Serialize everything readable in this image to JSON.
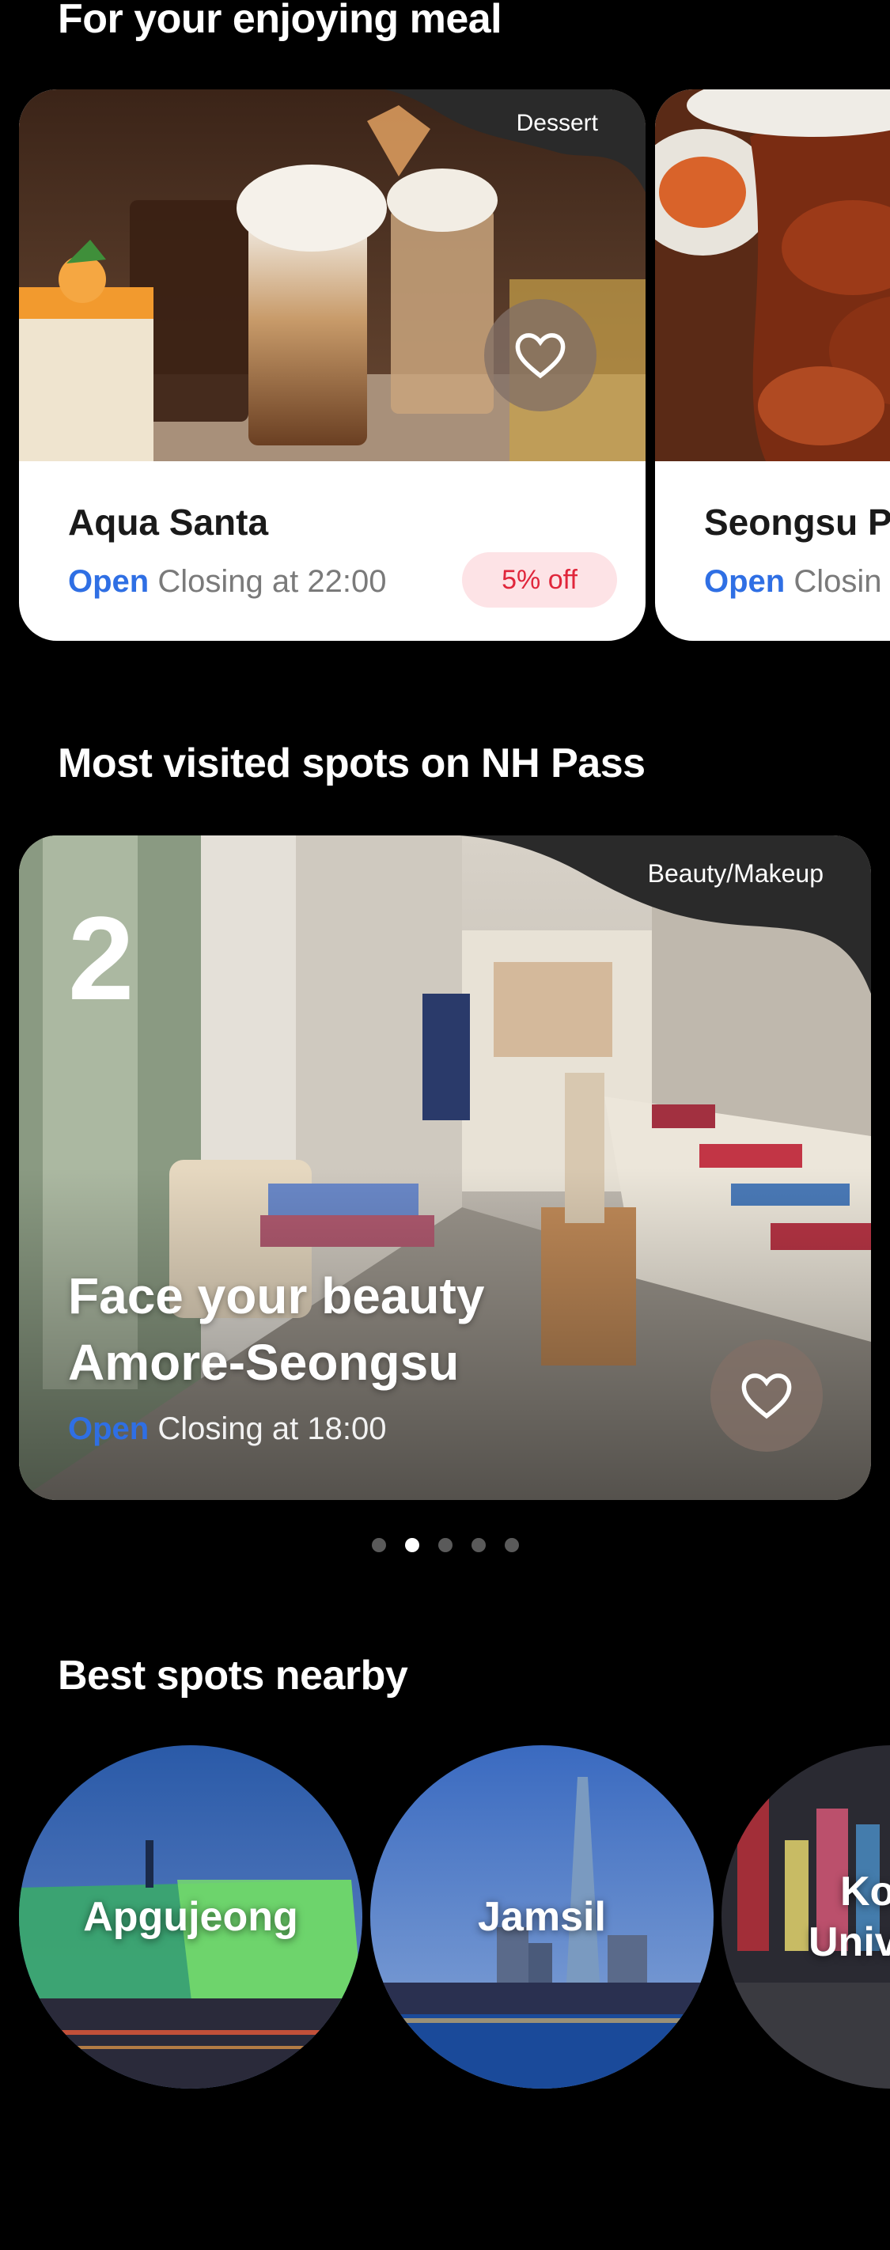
{
  "meal_section": {
    "title": "For your enjoying meal",
    "cards": [
      {
        "name": "Aqua Santa",
        "tag": "Dessert",
        "open": "Open",
        "closing": "Closing at 22:00",
        "discount": "5% off"
      },
      {
        "name": "Seongsu P",
        "open": "Open",
        "closing": "Closin"
      }
    ]
  },
  "visited_section": {
    "title": "Most visited spots on NH Pass",
    "card": {
      "rank": "2",
      "tag": "Beauty/Makeup",
      "title_line1": "Face your beauty",
      "title_line2": "Amore-Seongsu",
      "open": "Open",
      "closing": "Closing at 18:00"
    },
    "pagination": {
      "total": 5,
      "active": 1
    }
  },
  "nearby_section": {
    "title": "Best spots nearby",
    "areas": [
      {
        "label": "Apgujeong"
      },
      {
        "label": "Jamsil"
      },
      {
        "label_line1": "Kon",
        "label_line2": "Unive"
      }
    ]
  },
  "icons": [
    "heart-outline-icon"
  ],
  "colors": {
    "background": "#000000",
    "open": "#2f6fe4",
    "discount_bg": "#fde3e6",
    "discount_text": "#e0263b"
  }
}
